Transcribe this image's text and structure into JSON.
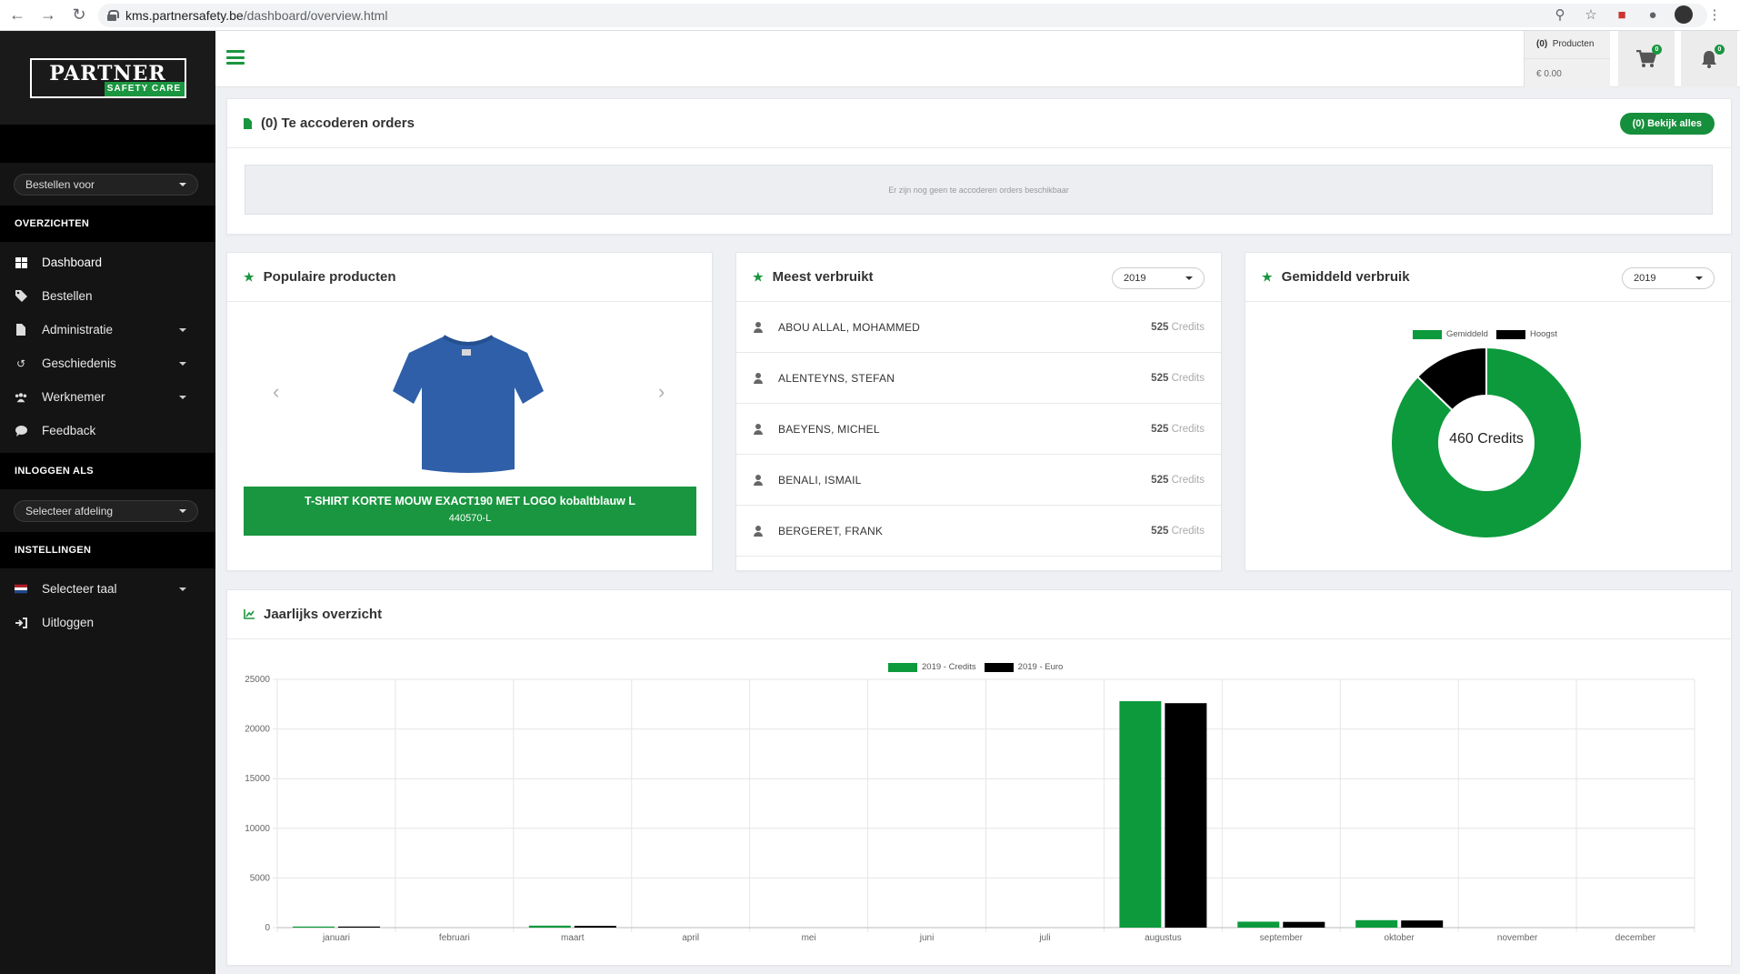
{
  "browser": {
    "url_host": "kms.partnersafety.be",
    "url_path": "/dashboard/overview.html"
  },
  "brand": {
    "logo_top": "PARTNER",
    "logo_bottom": "SAFETY CARE",
    "accent": "#1a9640"
  },
  "sidebar": {
    "order_for_select": "Bestellen voor",
    "section_overviews": "OVERZICHTEN",
    "items": [
      {
        "label": "Dashboard",
        "icon": "dashboard-icon"
      },
      {
        "label": "Bestellen",
        "icon": "tag-icon"
      },
      {
        "label": "Administratie",
        "icon": "document-icon"
      },
      {
        "label": "Geschiedenis",
        "icon": "history-icon"
      },
      {
        "label": "Werknemer",
        "icon": "users-icon"
      },
      {
        "label": "Feedback",
        "icon": "chat-icon"
      }
    ],
    "section_login_as": "INLOGGEN ALS",
    "department_select": "Selecteer afdeling",
    "section_settings": "INSTELLINGEN",
    "settings_items": [
      {
        "label": "Selecteer taal",
        "icon": "flag-nl-icon"
      },
      {
        "label": "Uitloggen",
        "icon": "logout-icon"
      }
    ]
  },
  "topbar": {
    "cart_count": "(0)",
    "cart_count_label": "Producten",
    "cart_total": "€ 0.00",
    "cart_badge": "0",
    "notif_badge": "0"
  },
  "orders_card": {
    "title": "(0) Te accoderen orders",
    "view_all": "(0) Bekijk alles",
    "empty_text": "Er zijn nog geen te accoderen orders beschikbaar"
  },
  "popular_card": {
    "title": "Populaire producten",
    "product_name": "T-SHIRT KORTE MOUW EXACT190 MET LOGO kobaltblauw L",
    "product_code": "440570-L",
    "shirt_color": "#2e5fa8"
  },
  "most_used_card": {
    "title": "Meest verbruikt",
    "year": "2019",
    "credit_word": "Credits",
    "employees": [
      {
        "name": "ABOU ALLAL, MOHAMMED",
        "credits": "525"
      },
      {
        "name": "ALENTEYNS, STEFAN",
        "credits": "525"
      },
      {
        "name": "BAEYENS, MICHEL",
        "credits": "525"
      },
      {
        "name": "BENALI, ISMAIL",
        "credits": "525"
      },
      {
        "name": "BERGERET, FRANK",
        "credits": "525"
      }
    ]
  },
  "avg_card": {
    "title": "Gemiddeld verbruik",
    "year": "2019",
    "legend_avg": "Gemiddeld",
    "legend_max": "Hoogst",
    "center_label": "460 Credits",
    "avg_fraction": 0.872,
    "colors": {
      "avg": "#0c9a3c",
      "max": "#000000"
    }
  },
  "yearly_card": {
    "title": "Jaarlijks overzicht"
  },
  "chart_data": {
    "type": "bar",
    "title": "",
    "xlabel": "",
    "ylabel": "",
    "ylim": [
      0,
      25000
    ],
    "yticks": [
      "0",
      "5000",
      "10000",
      "15000",
      "20000",
      "25000"
    ],
    "grid": true,
    "legend_position": "top",
    "categories": [
      "januari",
      "februari",
      "maart",
      "april",
      "mei",
      "juni",
      "juli",
      "augustus",
      "september",
      "oktober",
      "november",
      "december"
    ],
    "series": [
      {
        "name": "2019 - Credits",
        "color": "#0c9a3c",
        "values": [
          50,
          0,
          200,
          0,
          0,
          0,
          0,
          22800,
          600,
          750,
          0,
          0
        ]
      },
      {
        "name": "2019 - Euro",
        "color": "#000000",
        "values": [
          30,
          0,
          180,
          0,
          0,
          0,
          0,
          22600,
          580,
          720,
          0,
          0
        ]
      }
    ]
  }
}
